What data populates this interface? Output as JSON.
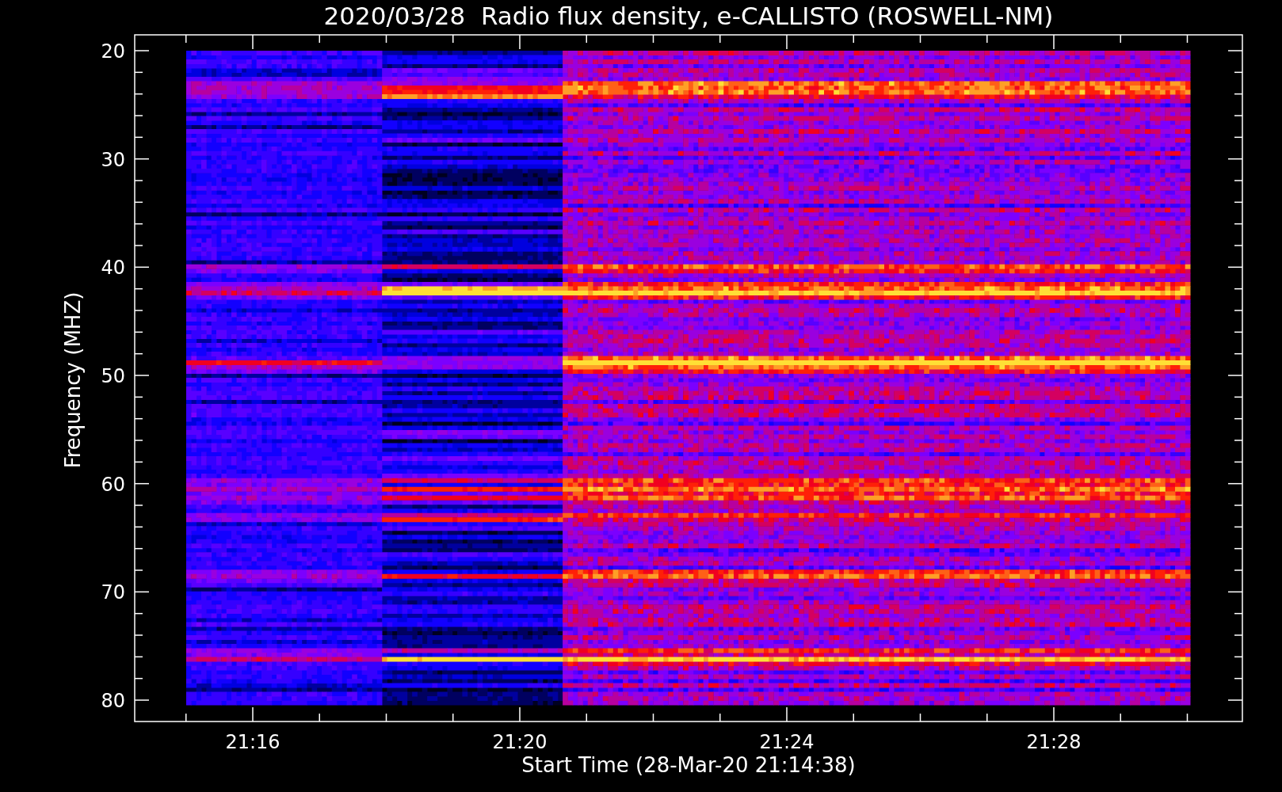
{
  "title": "2020/03/28  Radio flux density, e-CALLISTO (ROSWELL-NM)",
  "y_axis": {
    "label": "Frequency (MHZ)",
    "ticks": [
      "20",
      "30",
      "40",
      "50",
      "60",
      "70",
      "80"
    ]
  },
  "x_axis": {
    "label": "Start Time (28-Mar-20 21:14:38)",
    "ticks": [
      "21:16",
      "21:20",
      "21:24",
      "21:28"
    ]
  }
}
